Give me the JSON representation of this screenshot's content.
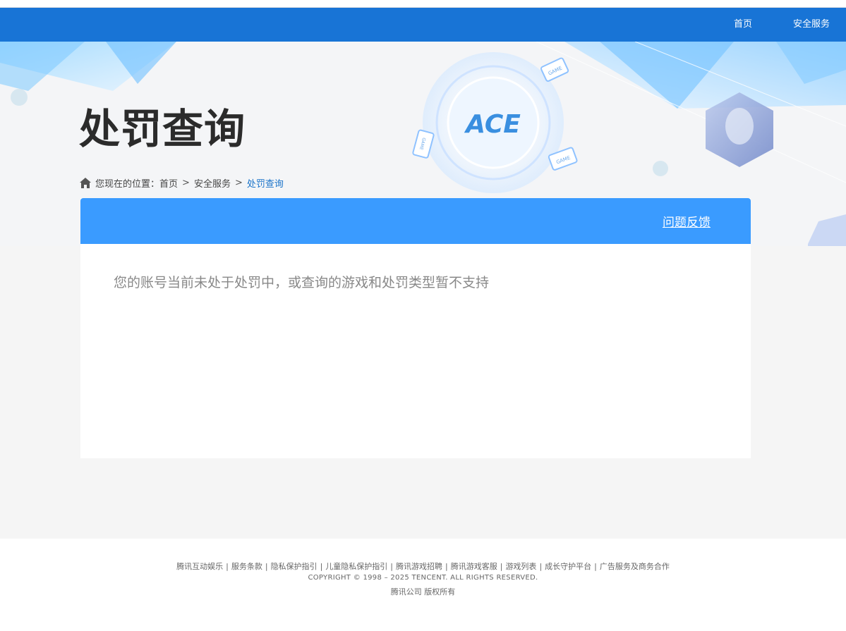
{
  "nav": {
    "home_label": "首页",
    "security_label": "安全服务"
  },
  "page": {
    "title": "处罚查询"
  },
  "breadcrumb": {
    "prefix": "您现在的位置：",
    "home": "首页",
    "sep1": ">",
    "security": "安全服务",
    "sep2": ">",
    "current": "处罚查询"
  },
  "panel": {
    "feedback_label": "问题反馈",
    "message": "您的账号当前未处于处罚中，或查询的游戏和处罚类型暂不支持"
  },
  "hero_decor": {
    "logo_text": "ACE",
    "card_labels": [
      "GAME",
      "GAME",
      "GAME"
    ]
  },
  "footer": {
    "links": [
      "腾讯互动娱乐",
      "服务条款",
      "隐私保护指引",
      "儿童隐私保护指引",
      "腾讯游戏招聘",
      "腾讯游戏客服",
      "游戏列表",
      "成长守护平台",
      "广告服务及商务合作"
    ],
    "separator": "|",
    "copyright": "COPYRIGHT © 1998 – 2025 TENCENT. ALL RIGHTS RESERVED.",
    "company": "腾讯公司 版权所有"
  },
  "colors": {
    "navbar": "#1874d6",
    "panel_header": "#3a9bff",
    "breadcrumb_current": "#1a73c9"
  }
}
